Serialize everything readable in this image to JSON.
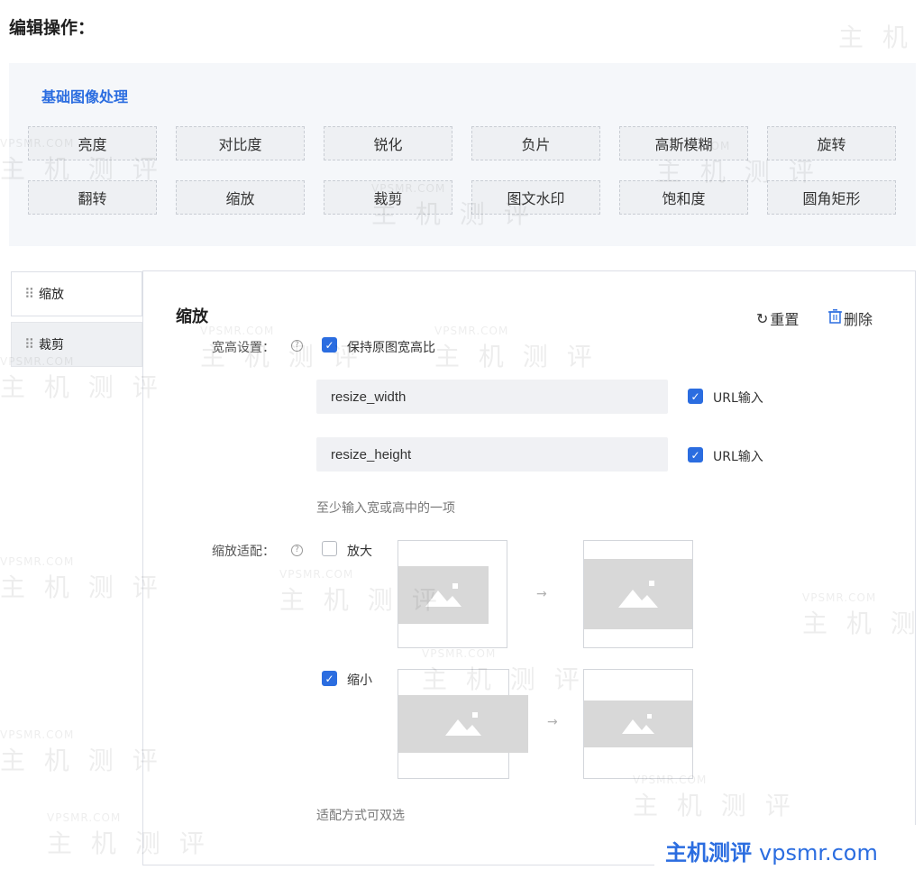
{
  "header": {
    "title": "编辑操作："
  },
  "operations": {
    "heading": "基础图像处理",
    "buttons": [
      "亮度",
      "对比度",
      "锐化",
      "负片",
      "高斯模糊",
      "旋转",
      "翻转",
      "缩放",
      "裁剪",
      "图文水印",
      "饱和度",
      "圆角矩形"
    ]
  },
  "sidebar": {
    "items": [
      {
        "label": "缩放",
        "active": true
      },
      {
        "label": "裁剪",
        "active": false
      }
    ]
  },
  "editor": {
    "title": "缩放",
    "reset_label": "重置",
    "delete_label": "删除",
    "size_setting": {
      "label": "宽高设置：",
      "keep_ratio_label": "保持原图宽高比",
      "keep_ratio_checked": true,
      "width_value": "resize_width",
      "height_value": "resize_height",
      "width_url_label": "URL输入",
      "width_url_checked": true,
      "height_url_label": "URL输入",
      "height_url_checked": true,
      "hint": "至少输入宽或高中的一项"
    },
    "fit_setting": {
      "label": "缩放适配：",
      "enlarge_label": "放大",
      "enlarge_checked": false,
      "shrink_label": "缩小",
      "shrink_checked": true,
      "hint": "适配方式可双选"
    }
  },
  "watermark": {
    "text": "主 机 测 评",
    "domain": "VPSMR.COM"
  },
  "brand": {
    "cn": "主机测评",
    "url": "vpsmr.com"
  },
  "colors": {
    "accent": "#2b6de0",
    "panel_bg": "#f5f7fa",
    "placeholder": "#d8d8d8"
  }
}
